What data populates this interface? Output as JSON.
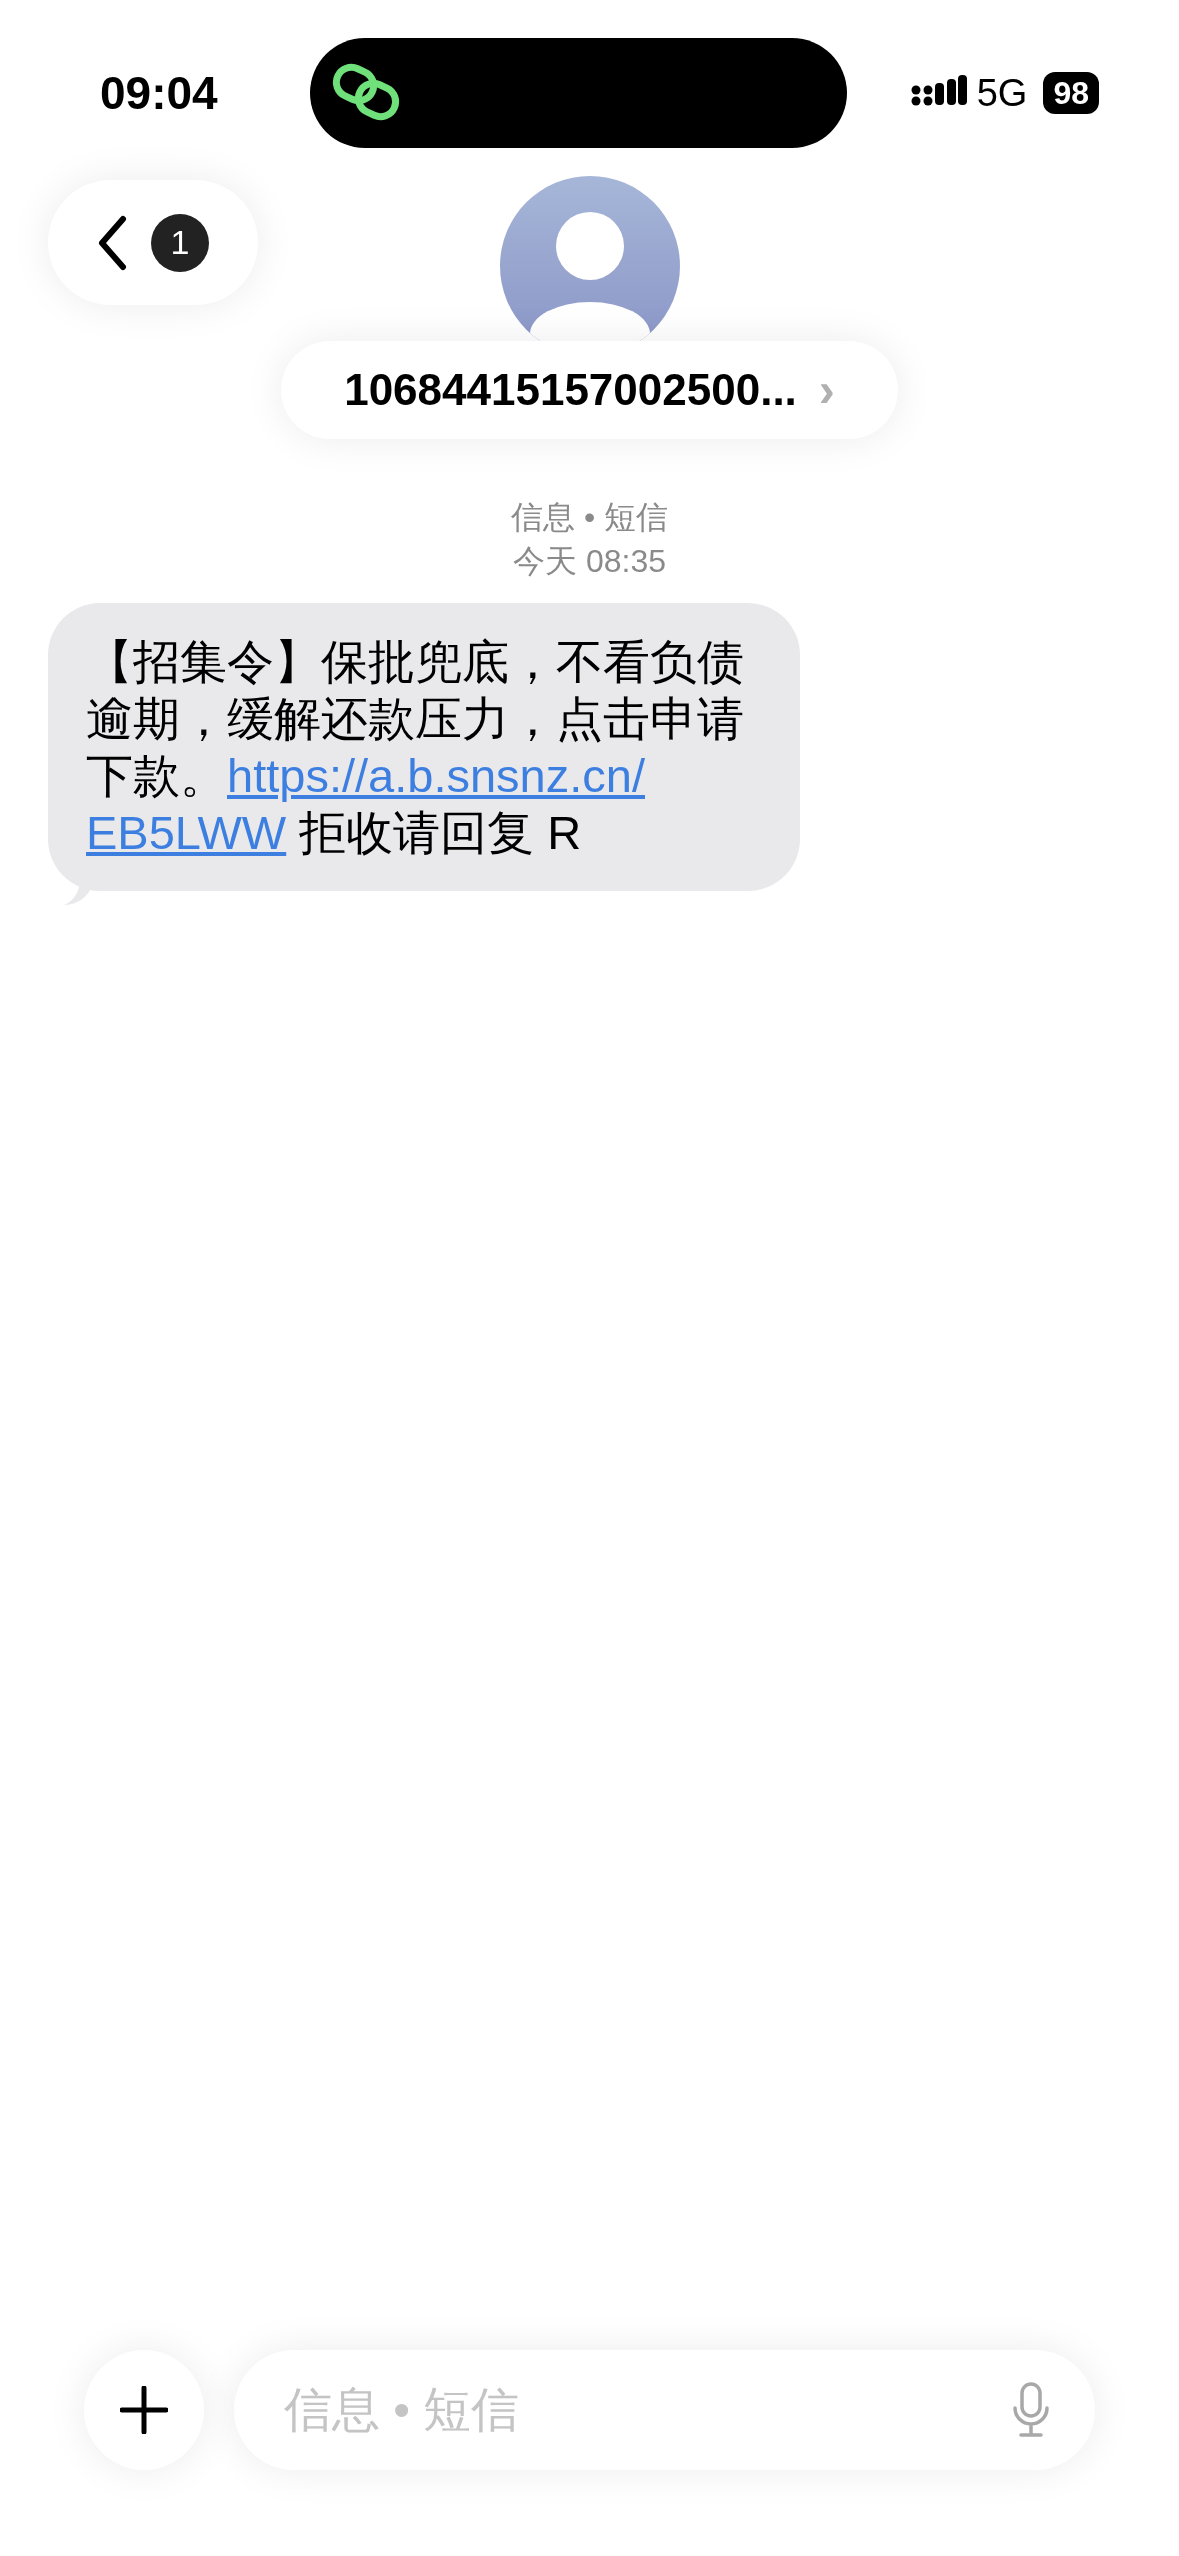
{
  "status_bar": {
    "time": "09:04",
    "network": "5G",
    "battery": "98"
  },
  "header": {
    "back_badge": "1",
    "contact": "10684415157002500...",
    "chevron": "›"
  },
  "meta": {
    "channel": "信息 • 短信",
    "timestamp": "今天 08:35"
  },
  "messages": [
    {
      "parts": [
        {
          "kind": "text",
          "text": "【招集令】保批兜底，不看负债逾期，缓解还款压力，点击申请下款。"
        },
        {
          "kind": "link",
          "text": "https://a.b.snsnz.cn/"
        },
        {
          "kind": "link",
          "text": "EB5LWW"
        },
        {
          "kind": "text",
          "text": " 拒收请回复 R"
        }
      ]
    }
  ],
  "composer": {
    "placeholder": "信息 • 短信"
  }
}
